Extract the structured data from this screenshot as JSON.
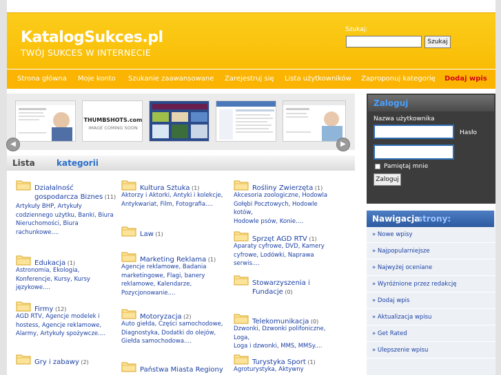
{
  "header": {
    "logo_title": "KatalogSukces.pl",
    "logo_subtitle": "TWÓJ SUKCES W INTERNECIE",
    "search_label": "Szukaj:",
    "search_value": "",
    "search_button": "Szukaj"
  },
  "nav": [
    {
      "label": "Strona główna",
      "highlight": false
    },
    {
      "label": "Moje konto",
      "highlight": false
    },
    {
      "label": "Szukanie zaawansowane",
      "highlight": false
    },
    {
      "label": "Zarejestruj się",
      "highlight": false
    },
    {
      "label": "Lista użytkowników",
      "highlight": false
    },
    {
      "label": "Zaproponuj kategorię",
      "highlight": false
    },
    {
      "label": "Dodaj wpis",
      "highlight": true
    }
  ],
  "carousel": {
    "thumbshots_label": "THUMBSHOTS.com",
    "coming_soon": "IMAGE COMING SOON",
    "prev": "◀",
    "next": "▶"
  },
  "categories": {
    "heading_main": "Lista",
    "heading_accent": "kategorii",
    "items": [
      {
        "name_l1": "Działalność",
        "name_l2": "gospodarcza Biznes",
        "count": "(11)",
        "subs": [
          "Artykuły BHP, Artykuły",
          "codziennego użytku, Banki, Biura",
          "Nieruchomości, Biura",
          "rachunkowe...."
        ]
      },
      {
        "name_l1": "Edukacja",
        "name_l2": "",
        "count": "(1)",
        "subs": [
          "Astronomia, Ekologia,",
          "Konferencje, Kursy, Kursy",
          "językowe...."
        ]
      },
      {
        "name_l1": "Firmy",
        "name_l2": "",
        "count": "(12)",
        "subs": [
          "AGD RTV, Agencje modelek i",
          "hostess, Agencje reklamowe,",
          "Alarmy, Artykuły spożywcze...."
        ]
      },
      {
        "name_l1": "Gry i zabawy",
        "name_l2": "",
        "count": "(2)",
        "subs": []
      },
      {
        "name_l1": "Kultura Sztuka",
        "name_l2": "",
        "count": "(1)",
        "subs": [
          "Aktorzy i Aktorki, Antyki i kolekcje,",
          "Antykwariat, Film, Fotografia...."
        ]
      },
      {
        "name_l1": "Law",
        "name_l2": "",
        "count": "(1)",
        "subs": []
      },
      {
        "name_l1": "Marketing Reklama",
        "name_l2": "",
        "count": "(1)",
        "subs": [
          "Agencje reklamowe, Badania",
          "marketingowe, Flagi, banery",
          "reklamowe, Kalendarze,",
          "Pozycjonowanie...."
        ]
      },
      {
        "name_l1": "Motoryzacja",
        "name_l2": "",
        "count": "(2)",
        "subs": [
          "Auto giełda, Części samochodowe,",
          "Diagnostyka, Dodatki do olejów,",
          "Giełda samochodowa...."
        ]
      },
      {
        "name_l1": "Państwa Miasta Regiony",
        "name_l2": "",
        "count": "",
        "subs": []
      },
      {
        "name_l1": "Rośliny Zwierzęta",
        "name_l2": "",
        "count": "(1)",
        "subs": [
          "Akcesoria zoologiczne, Hodowla",
          "Gołębi Pocztowych, Hodowle kotów,",
          "Hodowle psów, Konie...."
        ]
      },
      {
        "name_l1": "Sprzęt AGD RTV",
        "name_l2": "",
        "count": "(1)",
        "subs": [
          "Aparaty cyfrowe, DVD, Kamery",
          "cyfrowe, Lodówki, Naprawa serwis...."
        ]
      },
      {
        "name_l1": "Stowarzyszenia i Fundacje",
        "name_l2": "",
        "count": "(0)",
        "subs": []
      },
      {
        "name_l1": "Telekomunikacja",
        "name_l2": "",
        "count": "(0)",
        "subs": [
          "Dzwonki, Dzwonki polifoniczne, Loga,",
          "Loga i dzwonki, MMS, MMSy...."
        ]
      },
      {
        "name_l1": "Turystyka Sport",
        "name_l2": "",
        "count": "(1)",
        "subs": [
          "Agroturystyka, Aktywny wypoczynek,"
        ]
      }
    ]
  },
  "login": {
    "title": "Zaloguj",
    "user_label": "Nazwa użytkownika",
    "pass_label": "Hasło",
    "remember_label": "Pamiętaj mnie",
    "button": "Zaloguj"
  },
  "navigation": {
    "heading_main": "Nawigacja",
    "heading_accent": "strony:",
    "items": [
      "» Nowe wpisy",
      "» Najpopularniejsze",
      "» Najwyżej oceniane",
      "» Wyróżnione przez redakcję",
      "» Dodaj wpis",
      "» Aktualizacja wpisu",
      "» Get Rated",
      "» Ulepszenie wpisu"
    ]
  },
  "colors": {
    "header_yellow": "#fbcd1b",
    "nav_orange": "#fab401",
    "link_blue": "#1a3fa3",
    "highlight_red": "#d6001c",
    "sidebar_blue": "#2d5aa0"
  }
}
